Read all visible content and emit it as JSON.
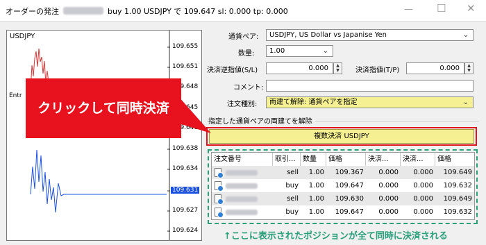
{
  "window": {
    "title_prefix": "オーダーの発注",
    "title_suffix": "buy 1.00 USDJPY で 109.647 sl: 0.000 tp: 0.000"
  },
  "chart": {
    "symbol": "USDJPY",
    "entry_label": "Entr",
    "price_labels": [
      "109.655",
      "109.651",
      "109.648",
      "109.645",
      "109.641",
      "109.638",
      "109.634",
      "109.631",
      "109.627",
      "109.624"
    ],
    "highlight_price": "109.631",
    "colors": {
      "bid_line": "#e03030",
      "ask_line": "#1a50e0",
      "highlight_bg": "#1a50e0"
    }
  },
  "form": {
    "currency_pair_label": "通貨ペア:",
    "currency_pair_value": "USDJPY, US Dollar vs Japanise Yen",
    "quantity_label": "数量:",
    "quantity_value": "1.00",
    "stop_loss_label": "決済逆指値(S/L)",
    "stop_loss_value": "0.000",
    "take_profit_label": "決済指値(T/P)",
    "take_profit_value": "0.000",
    "comment_label": "コメント:",
    "comment_value": "",
    "order_type_label": "注文種別:",
    "order_type_value": "両建て解除: 通貨ペアを指定"
  },
  "close_group": {
    "label": "指定した通貨ペアの両建てを解除",
    "button_label": "複数決済 USDJPY"
  },
  "table": {
    "headers": [
      "注文番号",
      "取引...",
      "数量",
      "価格",
      "決済...",
      "決済...",
      "価格"
    ],
    "rows": [
      {
        "type": "sell",
        "volume": "1.00",
        "price": "109.367",
        "sl": "0.000",
        "tp": "0.000",
        "close_price": "109.649"
      },
      {
        "type": "buy",
        "volume": "1.00",
        "price": "109.647",
        "sl": "0.000",
        "tp": "0.000",
        "close_price": "109.632"
      },
      {
        "type": "sell",
        "volume": "1.00",
        "price": "109.630",
        "sl": "0.000",
        "tp": "0.000",
        "close_price": "109.649"
      },
      {
        "type": "buy",
        "volume": "1.00",
        "price": "109.647",
        "sl": "0.000",
        "tp": "0.000",
        "close_price": "109.632"
      }
    ]
  },
  "annotations": {
    "callout_text": "クリックして同時決済",
    "bottom_caption": "↑ここに表示されたポジションが全て同時に決済される",
    "colors": {
      "callout": "#e8121e",
      "caption": "#2aa07a",
      "button_bg": "#f5f192"
    }
  }
}
